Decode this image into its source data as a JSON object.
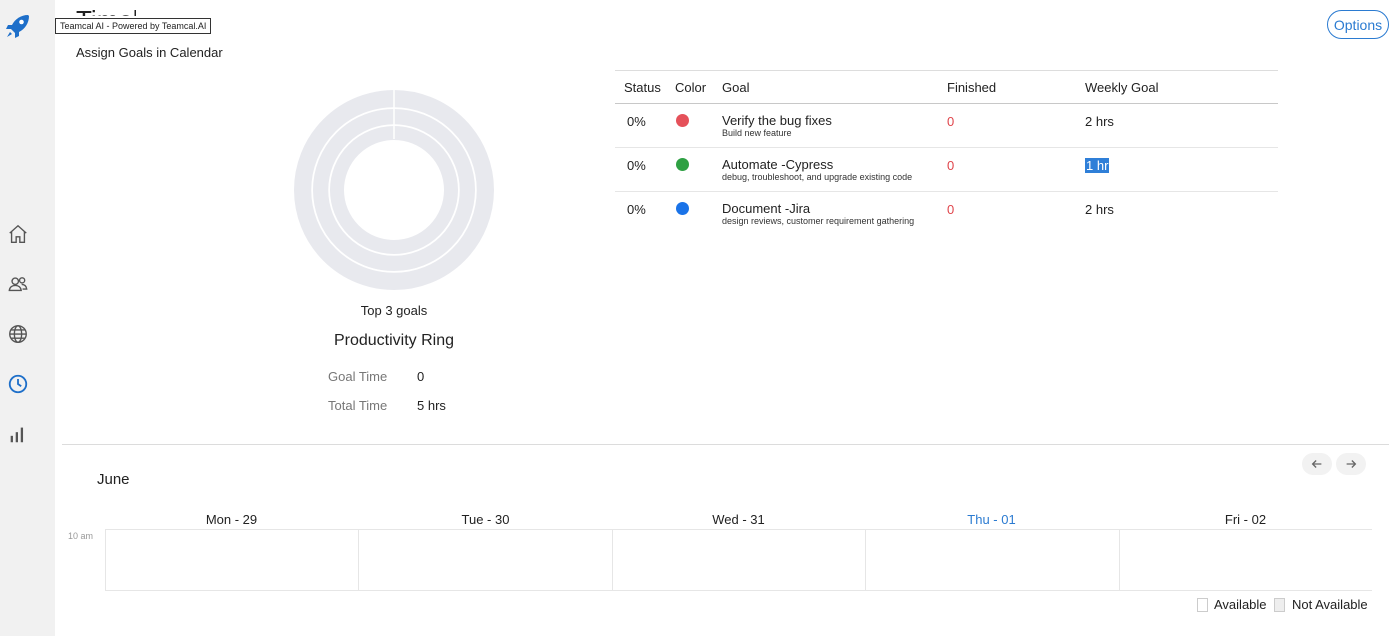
{
  "app": {
    "tooltip": "Teamcal AI - Powered by Teamcal.AI",
    "title": "Timeline",
    "assign_label": "Assign Goals in Calendar",
    "options_label": "Options"
  },
  "sidebar": {
    "logo_icon": "rocket-icon",
    "items": [
      {
        "icon": "home-icon"
      },
      {
        "icon": "users-icon"
      },
      {
        "icon": "globe-icon"
      },
      {
        "icon": "clock-icon",
        "active": true
      },
      {
        "icon": "bar-chart-icon"
      }
    ]
  },
  "ring": {
    "caption": "Top 3 goals",
    "title": "Productivity Ring",
    "goal_time_label": "Goal Time",
    "goal_time_value": "0",
    "total_time_label": "Total Time",
    "total_time_value": "5 hrs"
  },
  "goals_table": {
    "headers": {
      "status": "Status",
      "color": "Color",
      "goal": "Goal",
      "finished": "Finished",
      "weekly_goal": "Weekly Goal"
    },
    "rows": [
      {
        "status": "0%",
        "color": "#e5515a",
        "goal": "Verify the bug fixes",
        "desc": "Build new feature",
        "finished": "0",
        "weekly": "2 hrs"
      },
      {
        "status": "0%",
        "color": "#2ea043",
        "goal": "Automate -Cypress",
        "desc": "debug, troubleshoot, and upgrade existing code",
        "finished": "0",
        "weekly": "1 hr"
      },
      {
        "status": "0%",
        "color": "#1a73e8",
        "goal": "Document -Jira",
        "desc": "design reviews, customer requirement gathering",
        "finished": "0",
        "weekly": "2 hrs"
      }
    ]
  },
  "calendar": {
    "month": "June",
    "prev_icon": "arrow-left-icon",
    "next_icon": "arrow-right-icon",
    "days": [
      {
        "label": "Mon - 29"
      },
      {
        "label": "Tue - 30"
      },
      {
        "label": "Wed - 31"
      },
      {
        "label": "Thu - 01",
        "today": true
      },
      {
        "label": "Fri - 02"
      }
    ],
    "time_label": "10 am",
    "legend": {
      "available": "Available",
      "not_available": "Not Available"
    }
  },
  "colors": {
    "accent": "#2b7bd1",
    "finished": "#e0454b",
    "ring": "#e8e9ee",
    "sidebar_bg": "#f1f1f1"
  }
}
